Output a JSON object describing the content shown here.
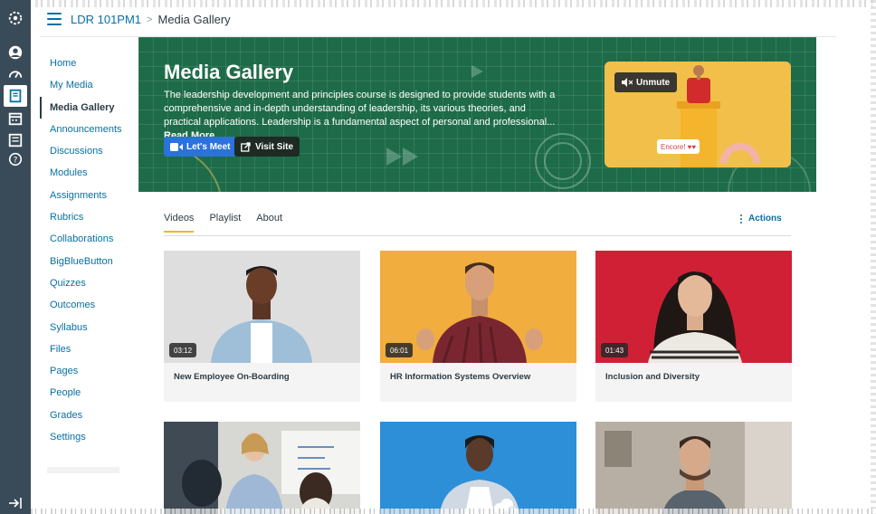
{
  "global_nav": {
    "icons": [
      "logo-icon",
      "account-icon",
      "dashboard-icon",
      "courses-icon",
      "calendar-icon",
      "inbox-icon",
      "help-icon",
      "collapse-icon"
    ]
  },
  "breadcrumb": {
    "course": "LDR 101PM1",
    "separator": ">",
    "current": "Media Gallery"
  },
  "course_nav": {
    "items": [
      {
        "label": "Home"
      },
      {
        "label": "My Media"
      },
      {
        "label": "Media Gallery"
      },
      {
        "label": "Announcements"
      },
      {
        "label": "Discussions"
      },
      {
        "label": "Modules"
      },
      {
        "label": "Assignments"
      },
      {
        "label": "Rubrics"
      },
      {
        "label": "Collaborations"
      },
      {
        "label": "BigBlueButton"
      },
      {
        "label": "Quizzes"
      },
      {
        "label": "Outcomes"
      },
      {
        "label": "Syllabus"
      },
      {
        "label": "Files"
      },
      {
        "label": "Pages"
      },
      {
        "label": "People"
      },
      {
        "label": "Grades"
      },
      {
        "label": "Settings"
      }
    ],
    "active_index": 2
  },
  "hero": {
    "title": "Media Gallery",
    "description": "The leadership development and principles course is designed to provide students with a comprehensive and in-depth understanding of leadership, its various theories, and practical applications. Leadership is a fundamental aspect of personal and professional...",
    "read_more": "Read More",
    "lets_meet_label": "Let's Meet",
    "visit_site_label": "Visit Site",
    "unmute_label": "Unmute",
    "encore_text": "Encore!",
    "background_color": "#1d6b48",
    "promo_color": "#f2c04a"
  },
  "tabs": {
    "items": [
      "Videos",
      "Playlist",
      "About"
    ],
    "active": "Videos",
    "actions_label": "Actions"
  },
  "videos": [
    {
      "title": "New Employee On-Boarding",
      "duration": "03:12",
      "bg": "#dedede"
    },
    {
      "title": "HR Information Systems Overview",
      "duration": "06:01",
      "bg": "#f1ad3e"
    },
    {
      "title": "Inclusion and Diversity",
      "duration": "01:43",
      "bg": "#cf2036"
    },
    {
      "title": "",
      "duration": "",
      "bg": "#d7d7d3"
    },
    {
      "title": "",
      "duration": "",
      "bg": "#2c8fd8"
    },
    {
      "title": "",
      "duration": "",
      "bg": "#bfb9b2"
    }
  ]
}
